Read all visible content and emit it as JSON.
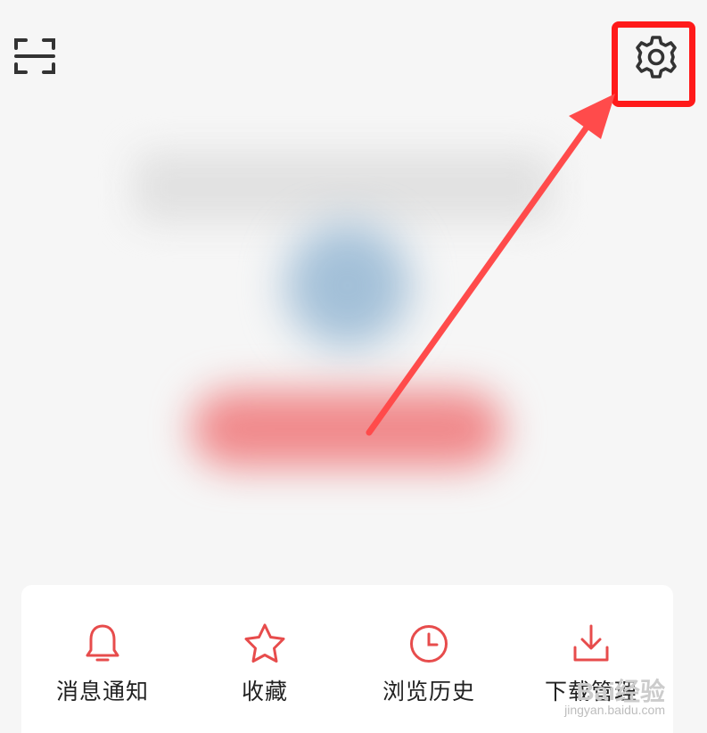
{
  "header": {
    "scan_icon": "scan-icon",
    "settings_icon": "gear-icon",
    "highlight_color": "#ff1a1a"
  },
  "annotation": {
    "arrow_color": "#ff4b4b"
  },
  "profile": {
    "avatar_color": "#a3c0d8",
    "login_button_color": "#f0898b"
  },
  "menu": {
    "accent_color": "#e74c4c",
    "items": [
      {
        "label": "消息通知",
        "icon": "bell-icon"
      },
      {
        "label": "收藏",
        "icon": "star-icon"
      },
      {
        "label": "浏览历史",
        "icon": "clock-icon"
      },
      {
        "label": "下载管理",
        "icon": "download-icon"
      }
    ]
  },
  "watermark": {
    "main": "Bai经验",
    "url": "jingyan.baidu.com"
  }
}
